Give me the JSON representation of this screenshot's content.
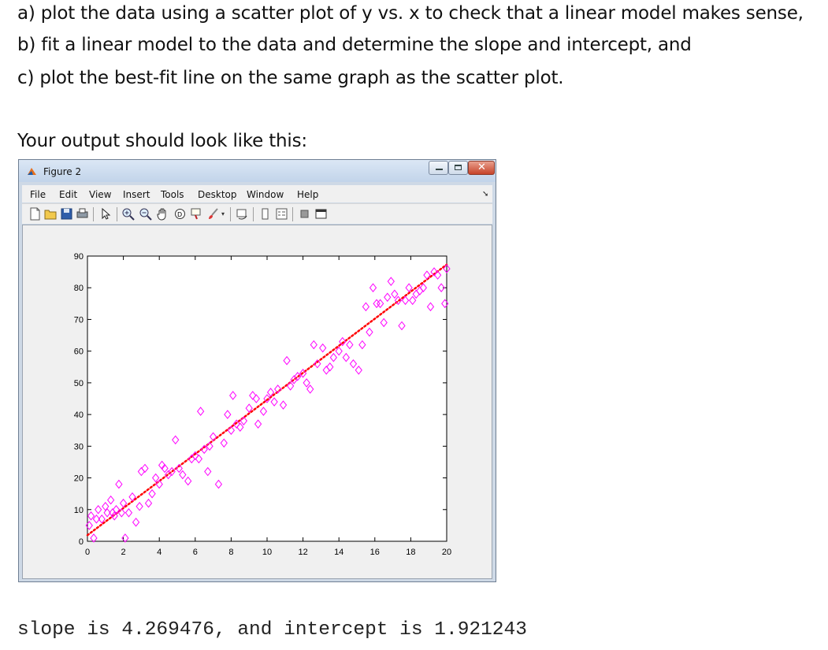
{
  "instructions": {
    "line_a": "a) plot the data using a scatter plot of y vs. x to check that a linear model makes sense,",
    "line_b": "b) fit a linear model to the data and determine the slope and intercept, and",
    "line_c": "c) plot the best-fit line on the same graph as the scatter plot."
  },
  "output_heading": "Your output should look like this:",
  "figure_window": {
    "title": "Figure 2",
    "menu": [
      "File",
      "Edit",
      "View",
      "Insert",
      "Tools",
      "Desktop",
      "Window",
      "Help"
    ],
    "toolbar_icons": [
      "new-figure-icon",
      "open-file-icon",
      "save-icon",
      "print-icon",
      "pointer-icon",
      "zoom-in-icon",
      "zoom-out-icon",
      "pan-hand-icon",
      "rotate-3d-icon",
      "data-cursor-icon",
      "brush-icon",
      "link-plot-icon",
      "colorbar-icon",
      "legend-icon",
      "hide-plot-tools-icon",
      "show-plot-tools-icon"
    ]
  },
  "colors": {
    "marker": "#ff00ff",
    "fit_line": "#ff0000",
    "titlebar": "#c9daf0"
  },
  "chart_data": {
    "type": "scatter",
    "title": "",
    "xlabel": "",
    "ylabel": "",
    "xlim": [
      0,
      20
    ],
    "ylim": [
      0,
      90
    ],
    "xticks": [
      "0",
      "2",
      "4",
      "6",
      "8",
      "10",
      "12",
      "14",
      "16",
      "18",
      "20"
    ],
    "yticks": [
      "0",
      "10",
      "20",
      "30",
      "40",
      "50",
      "60",
      "70",
      "80",
      "90"
    ],
    "grid": false,
    "series": [
      {
        "marker": "diamond",
        "color": "#ff00ff",
        "x": [
          0.1,
          0.2,
          0.35,
          0.5,
          0.6,
          0.8,
          1.0,
          1.1,
          1.3,
          1.4,
          1.5,
          1.6,
          1.75,
          1.9,
          2.0,
          2.1,
          2.3,
          2.5,
          2.7,
          2.9,
          3.0,
          3.2,
          3.4,
          3.6,
          3.8,
          4.0,
          4.15,
          4.3,
          4.5,
          4.7,
          4.9,
          5.1,
          5.3,
          5.6,
          5.8,
          6.0,
          6.2,
          6.3,
          6.5,
          6.7,
          6.8,
          7.0,
          7.3,
          7.6,
          7.8,
          8.0,
          8.1,
          8.3,
          8.5,
          8.7,
          9.0,
          9.2,
          9.4,
          9.5,
          9.8,
          10.0,
          10.2,
          10.4,
          10.6,
          10.9,
          11.1,
          11.3,
          11.5,
          11.7,
          12.0,
          12.2,
          12.4,
          12.6,
          12.8,
          13.1,
          13.3,
          13.5,
          13.7,
          14.0,
          14.2,
          14.4,
          14.6,
          14.8,
          15.1,
          15.3,
          15.5,
          15.7,
          15.9,
          16.1,
          16.3,
          16.5,
          16.7,
          16.9,
          17.1,
          17.3,
          17.5,
          17.7,
          17.9,
          18.1,
          18.3,
          18.5,
          18.7,
          18.9,
          19.1,
          19.3,
          19.5,
          19.7,
          19.9,
          20.0
        ],
        "y": [
          5,
          8,
          1,
          7,
          10,
          7,
          11,
          9,
          13,
          9,
          8,
          10,
          18,
          9,
          12,
          1,
          9,
          14,
          6,
          11,
          22,
          23,
          12,
          15,
          20,
          18,
          24,
          23,
          21,
          22,
          32,
          23,
          21,
          19,
          26,
          27,
          26,
          41,
          29,
          22,
          30,
          33,
          18,
          31,
          40,
          35,
          46,
          37,
          36,
          38,
          42,
          46,
          45,
          37,
          41,
          45,
          47,
          44,
          48,
          43,
          57,
          49,
          51,
          52,
          53,
          50,
          48,
          62,
          56,
          61,
          54,
          55,
          58,
          60,
          63,
          58,
          62,
          56,
          54,
          62,
          74,
          66,
          80,
          75,
          75,
          69,
          77,
          82,
          78,
          76,
          68,
          76,
          80,
          76,
          78,
          79,
          80,
          84,
          74,
          85,
          84,
          80,
          75,
          86
        ],
        "points_x_note": ""
      },
      {
        "name": "",
        "type": "line",
        "style": "dotted",
        "color": "#ff0000",
        "x": [
          0,
          20
        ],
        "y": [
          1.921243,
          87.310763
        ]
      }
    ]
  },
  "result": "slope is 4.269476, and intercept is 1.921243"
}
